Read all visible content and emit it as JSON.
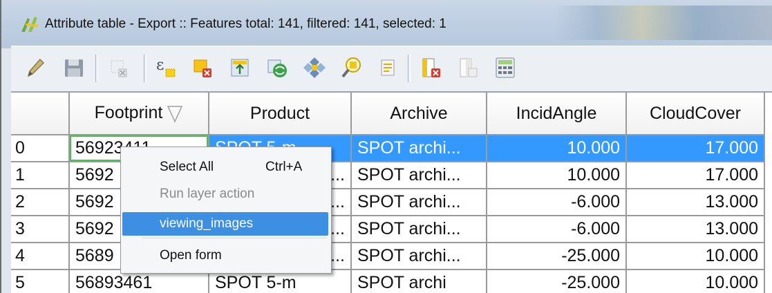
{
  "window": {
    "title": "Attribute table - Export :: Features total: 141, filtered: 141, selected: 1"
  },
  "toolbar": {
    "buttons": [
      {
        "name": "toggle-editing",
        "icon": "pencil-icon",
        "enabled": false
      },
      {
        "name": "save-edits",
        "icon": "save-icon",
        "enabled": false
      },
      {
        "name": "delete-selected",
        "icon": "delete-features-icon",
        "enabled": false
      },
      {
        "name": "select-by-expression",
        "icon": "expression-select-icon",
        "enabled": true
      },
      {
        "name": "unselect-all",
        "icon": "unselect-icon",
        "enabled": true
      },
      {
        "name": "move-selection-top",
        "icon": "move-to-top-icon",
        "enabled": true
      },
      {
        "name": "invert-selection",
        "icon": "invert-selection-icon",
        "enabled": true
      },
      {
        "name": "pan-to-selected",
        "icon": "pan-to-selection-icon",
        "enabled": true
      },
      {
        "name": "zoom-to-selected",
        "icon": "zoom-to-selection-icon",
        "enabled": true
      },
      {
        "name": "copy-selected",
        "icon": "copy-rows-icon",
        "enabled": true
      },
      {
        "name": "delete-column",
        "icon": "delete-column-icon",
        "enabled": true
      },
      {
        "name": "new-column",
        "icon": "new-column-icon",
        "enabled": false
      },
      {
        "name": "field-calculator",
        "icon": "field-calculator-icon",
        "enabled": true
      }
    ]
  },
  "table": {
    "columns": [
      "Footprint",
      "Product",
      "Archive",
      "IncidAngle",
      "CloudCover"
    ],
    "sorted_column": "Footprint",
    "rows": [
      {
        "id": "0",
        "cells": [
          "56923411",
          "SPOT 5-m...",
          "SPOT archi...",
          "10.000",
          "17.000"
        ],
        "selected": true
      },
      {
        "id": "1",
        "cells": [
          "5692",
          "...",
          "SPOT archi...",
          "10.000",
          "17.000"
        ],
        "selected": false
      },
      {
        "id": "2",
        "cells": [
          "5692",
          "...",
          "SPOT archi...",
          "-6.000",
          "13.000"
        ],
        "selected": false
      },
      {
        "id": "3",
        "cells": [
          "5692",
          "...",
          "SPOT archi...",
          "-6.000",
          "13.000"
        ],
        "selected": false
      },
      {
        "id": "4",
        "cells": [
          "5689",
          "...",
          "SPOT archi...",
          "-25.000",
          "10.000"
        ],
        "selected": false
      },
      {
        "id": "5",
        "cells": [
          "56893461",
          "SPOT 5-m",
          "SPOT archi",
          "-25.000",
          "10.000"
        ],
        "selected": false
      }
    ]
  },
  "context_menu": {
    "items": [
      {
        "label": "Select All",
        "shortcut": "Ctrl+A",
        "enabled": true,
        "highlighted": false
      },
      {
        "label": "Run layer action",
        "shortcut": "",
        "enabled": false,
        "highlighted": false
      },
      {
        "label": "viewing_images",
        "shortcut": "",
        "enabled": true,
        "highlighted": true
      },
      {
        "label": "Open form",
        "shortcut": "",
        "enabled": true,
        "highlighted": false
      }
    ]
  },
  "colors": {
    "selection": "#3399ff",
    "menu_highlight": "#3c8fe3",
    "current_cell_outline": "#47c24f"
  }
}
